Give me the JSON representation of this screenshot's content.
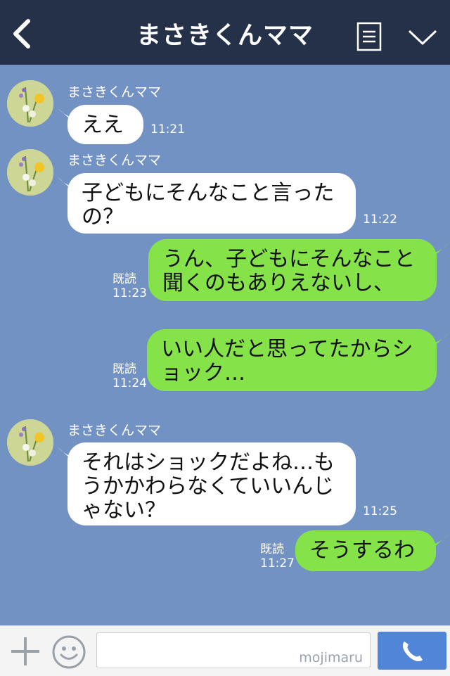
{
  "header": {
    "title": "まさきくんママ"
  },
  "messages": [
    {
      "side": "in",
      "sender": "まさきくんママ",
      "text": "ええ",
      "time": "11:21"
    },
    {
      "side": "in",
      "sender": "まさきくんママ",
      "text": "子どもにそんなこと言った\nの？",
      "time": "11:22"
    },
    {
      "side": "out",
      "text": "うん、子どもにそんなこと\n聞くのもありえないし、",
      "read": "既読",
      "time": "11:23"
    },
    {
      "side": "out",
      "text": "いい人だと思ってたからシ\nョック…",
      "read": "既読",
      "time": "11:24"
    },
    {
      "side": "in",
      "sender": "まさきくんママ",
      "text": "それはショックだよね…も\nうかかわらなくていいんじ\nゃない？",
      "time": "11:25"
    },
    {
      "side": "out",
      "text": "そうするわ",
      "read": "既読",
      "time": "11:27"
    }
  ],
  "footer": {
    "input_value": "",
    "watermark": "mojimaru"
  },
  "colors": {
    "chat_background": "#7292c4",
    "header_background": "#243149",
    "incoming_bubble": "#ffffff",
    "outgoing_bubble": "#85e249",
    "call_button": "#5185d8"
  },
  "icons": [
    "back-arrow-icon",
    "menu-list-icon",
    "chevron-down-icon",
    "plus-icon",
    "emoji-icon",
    "phone-icon",
    "avatar-flower-image"
  ]
}
